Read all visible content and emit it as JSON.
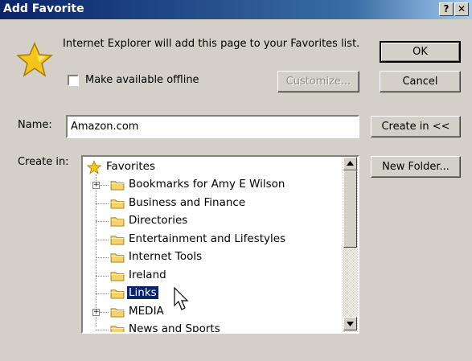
{
  "window": {
    "title": "Add Favorite",
    "help_label": "?",
    "close_label": "✕"
  },
  "message": "Internet Explorer will add this page to your Favorites list.",
  "offline": {
    "label": "Make available offline",
    "checked": false
  },
  "buttons": {
    "ok": "OK",
    "cancel": "Cancel",
    "customize": "Customize...",
    "create_in": "Create in <<",
    "new_folder": "New Folder..."
  },
  "name": {
    "label": "Name:",
    "value": "Amazon.com"
  },
  "create_in": {
    "label": "Create in:",
    "root": "Favorites",
    "items": [
      {
        "label": "Bookmarks for Amy E Wilson",
        "expandable": true
      },
      {
        "label": "Business and Finance",
        "expandable": false
      },
      {
        "label": "Directories",
        "expandable": false
      },
      {
        "label": "Entertainment and Lifestyles",
        "expandable": false
      },
      {
        "label": "Internet Tools",
        "expandable": false
      },
      {
        "label": "Ireland",
        "expandable": false
      },
      {
        "label": "Links",
        "expandable": false,
        "selected": true
      },
      {
        "label": "MEDIA",
        "expandable": true
      },
      {
        "label": "News and Sports",
        "expandable": false
      }
    ]
  },
  "icons": {
    "favorites": "star-icon",
    "folder": "folder-icon",
    "cursor": "mouse-pointer-icon"
  },
  "colors": {
    "titlebar": "#0a246a",
    "selection": "#0a246a",
    "folder": "#f5d36a",
    "star": "#f6c51b"
  }
}
